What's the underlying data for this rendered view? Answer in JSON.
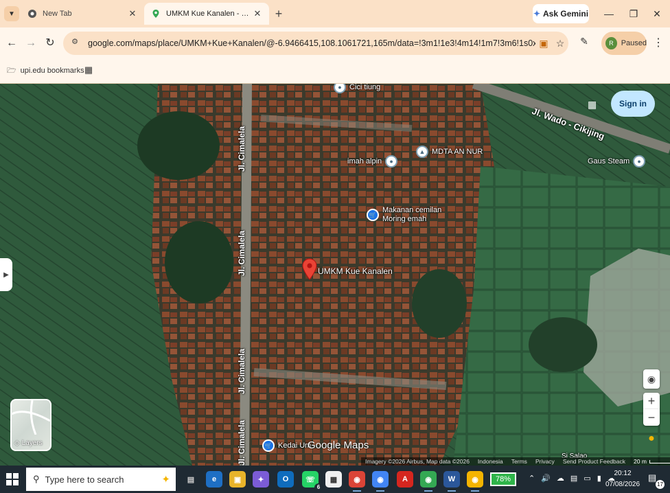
{
  "browser": {
    "tabs": [
      {
        "title": "New Tab",
        "active": false
      },
      {
        "title": "UMKM Kue Kanalen - Google Maps",
        "active": true
      }
    ],
    "gemini_label": "Ask Gemini",
    "url": "google.com/maps/place/UMKM+Kue+Kanalen/@-6.9466415,108.1061721,165m/data=!3m1!1e3!4m14!1m7!3m6!1s0x2e6f330051ec220...",
    "profile_status": "Paused",
    "profile_initial": "R",
    "bookmarks": [
      {
        "label": "upi.edu bookmarks"
      }
    ]
  },
  "map": {
    "streets": [
      {
        "name": "Jl. Wado - Cikijing"
      },
      {
        "name": "Jl. Cimalela"
      },
      {
        "name": "Jl. Cimalela"
      },
      {
        "name": "Jl. Cimalela"
      },
      {
        "name": "Jl. Cimalela"
      }
    ],
    "pois": [
      {
        "name": "Cici tiung"
      },
      {
        "name": "MDTA AN NUR"
      },
      {
        "name": "imah alpin"
      },
      {
        "name": "Gaus Steam"
      },
      {
        "name": "Makanan cemilan\nMoring emah"
      },
      {
        "name": "Kedai Um"
      },
      {
        "name": "Si Salao"
      }
    ],
    "selected_place": "UMKM Kue Kanalen",
    "sign_in_label": "Sign in",
    "layers_label": "Layers",
    "logo_text": "Google Maps",
    "footer": {
      "imagery": "Imagery ©2026 Airbus, Map data ©2026",
      "region": "Indonesia",
      "terms": "Terms",
      "privacy": "Privacy",
      "feedback": "Send Product Feedback",
      "scale": "20 m"
    }
  },
  "taskbar": {
    "search_placeholder": "Type here to search",
    "battery": "78%",
    "time": "20:12",
    "date": "07/08/2026",
    "notification_count": "17",
    "whatsapp_badge": "6",
    "apps": [
      "task-view",
      "edge",
      "file-explorer",
      "copilot",
      "outlook",
      "whatsapp",
      "store",
      "chrome",
      "chrome",
      "acrobat",
      "chrome",
      "word",
      "chrome"
    ]
  }
}
